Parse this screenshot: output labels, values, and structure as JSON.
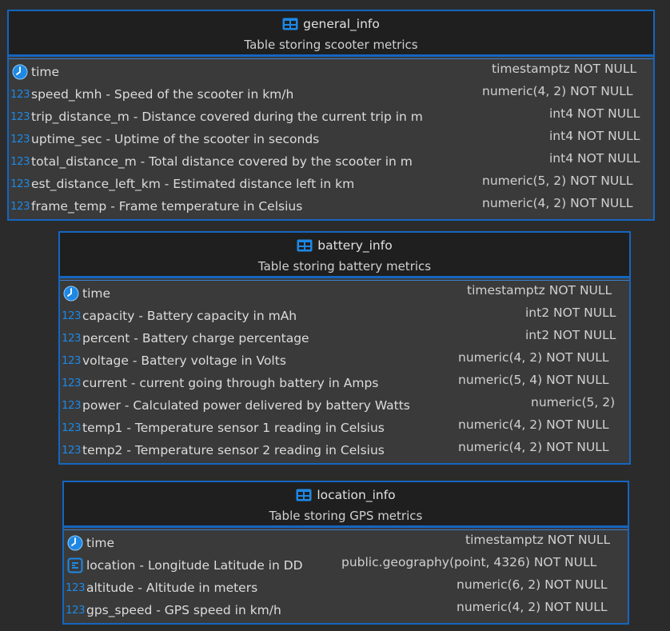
{
  "tables": [
    {
      "name": "general_info",
      "description": "Table storing scooter metrics",
      "columns": [
        {
          "icon": "clock-icon",
          "name": "time",
          "type": "timestamptz NOT NULL"
        },
        {
          "icon": "numeric-icon",
          "name": "speed_kmh - Speed of the scooter in km/h",
          "type": "numeric(4, 2) NOT NULL"
        },
        {
          "icon": "numeric-icon",
          "name": "trip_distance_m - Distance covered during the current trip in m",
          "type": "int4 NOT NULL"
        },
        {
          "icon": "numeric-icon",
          "name": "uptime_sec - Uptime of the scooter in seconds",
          "type": "int4 NOT NULL"
        },
        {
          "icon": "numeric-icon",
          "name": "total_distance_m - Total distance covered by the scooter in m",
          "type": "int4 NOT NULL"
        },
        {
          "icon": "numeric-icon",
          "name": "est_distance_left_km - Estimated distance left in km",
          "type": "numeric(5, 2) NOT NULL"
        },
        {
          "icon": "numeric-icon",
          "name": "frame_temp - Frame temperature in Celsius",
          "type": "numeric(4, 2) NOT NULL"
        }
      ]
    },
    {
      "name": "battery_info",
      "description": "Table storing battery metrics",
      "columns": [
        {
          "icon": "clock-icon",
          "name": "time",
          "type": "timestamptz NOT NULL"
        },
        {
          "icon": "numeric-icon",
          "name": "capacity - Battery capacity in mAh",
          "type": "int2 NOT NULL"
        },
        {
          "icon": "numeric-icon",
          "name": "percent - Battery charge percentage",
          "type": "int2 NOT NULL"
        },
        {
          "icon": "numeric-icon",
          "name": "voltage - Battery voltage in Volts",
          "type": "numeric(4, 2) NOT NULL"
        },
        {
          "icon": "numeric-icon",
          "name": "current - current going through battery in Amps",
          "type": "numeric(5, 4) NOT NULL"
        },
        {
          "icon": "numeric-icon",
          "name": "power - Calculated power delivered by battery Watts",
          "type": "numeric(5, 2)"
        },
        {
          "icon": "numeric-icon",
          "name": "temp1 - Temperature sensor 1 reading in Celsius",
          "type": "numeric(4, 2) NOT NULL"
        },
        {
          "icon": "numeric-icon",
          "name": "temp2 - Temperature sensor 2 reading in Celsius",
          "type": "numeric(4, 2) NOT NULL"
        }
      ]
    },
    {
      "name": "location_info",
      "description": "Table storing GPS metrics",
      "columns": [
        {
          "icon": "clock-icon",
          "name": "time",
          "type": "timestamptz NOT NULL"
        },
        {
          "icon": "geography-icon",
          "name": "location - Longitude Latitude in DD",
          "type": "public.geography(point, 4326) NOT NULL"
        },
        {
          "icon": "numeric-icon",
          "name": "altitude - Altitude in meters",
          "type": "numeric(6, 2) NOT NULL"
        },
        {
          "icon": "numeric-icon",
          "name": "gps_speed - GPS speed in km/h",
          "type": "numeric(4, 2) NOT NULL"
        }
      ]
    }
  ],
  "numeric_icon_text": "123",
  "colors": {
    "border": "#1565c0",
    "icon_blue": "#1e88e5",
    "background": "#2b2b2b",
    "panel": "#3a3a3a"
  }
}
